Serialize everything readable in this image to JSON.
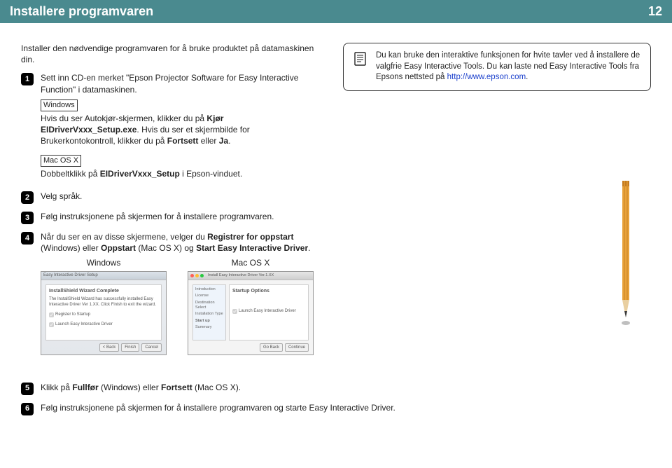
{
  "header": {
    "title": "Installere programvaren",
    "page": "12"
  },
  "intro": "Installer den nødvendige programvaren for å bruke produktet på datamaskinen din.",
  "steps": {
    "s1": {
      "num": "1",
      "text": "Sett inn CD-en merket \"Epson Projector Software for Easy Interactive Function\" i datamaskinen.",
      "win_label": "Windows",
      "win_p1a": "Hvis du ser Autokjør-skjermen, klikker du på ",
      "win_p1b": "Kjør EIDriverVxxx_Setup.exe",
      "win_p1c": ". Hvis du ser et skjermbilde for Brukerkontokontroll, klikker du på ",
      "win_p1d": "Fortsett",
      "win_p1e": " eller ",
      "win_p1f": "Ja",
      "win_p1g": ".",
      "mac_label": "Mac OS X",
      "mac_p1a": "Dobbeltklikk på ",
      "mac_p1b": "EIDriverVxxx_Setup",
      "mac_p1c": " i Epson-vinduet."
    },
    "s2": {
      "num": "2",
      "text": "Velg språk."
    },
    "s3": {
      "num": "3",
      "text": "Følg instruksjonene på skjermen for å installere programvaren."
    },
    "s4": {
      "num": "4",
      "p1a": "Når du ser en av disse skjermene, velger du ",
      "p1b": "Registrer for oppstart",
      "p1c": " (Windows) eller ",
      "p1d": "Oppstart",
      "p1e": " (Mac OS X) og ",
      "p1f": "Start Easy Interactive Driver",
      "p1g": ".",
      "win_label": "Windows",
      "mac_label": "Mac OS X",
      "shot_win": {
        "titlebar": "Easy Interactive Driver Setup",
        "h": "InstallShield Wizard Complete",
        "body": "The InstallShield Wizard has successfully installed Easy Interactive Driver Ver 1.XX. Click Finish to exit the wizard.",
        "chk1": "Register to Startup",
        "chk2": "Launch Easy Interactive Driver",
        "btn_back": "< Back",
        "btn_finish": "Finish",
        "btn_cancel": "Cancel"
      },
      "shot_mac": {
        "titlebar": "Install Easy Interactive Driver Ver.1.XX",
        "main_h": "Startup Options",
        "side1": "Introduction",
        "side2": "License",
        "side3": "Destination Select",
        "side4": "Installation Type",
        "side5": "Start up",
        "side6": "Summary",
        "chk": "Launch Easy Interactive Driver",
        "btn_back": "Go Back",
        "btn_cont": "Continue"
      }
    },
    "s5": {
      "num": "5",
      "p1a": "Klikk på ",
      "p1b": "Fullfør",
      "p1c": " (Windows) eller ",
      "p1d": "Fortsett",
      "p1e": " (Mac OS X)."
    },
    "s6": {
      "num": "6",
      "text": "Følg instruksjonene på skjermen for å installere programvaren og starte Easy Interactive Driver."
    }
  },
  "note": {
    "p1": "Du kan bruke den interaktive funksjonen for hvite tavler ved å installere de valgfrie Easy Interactive Tools. Du kan laste ned Easy Interactive Tools fra Epsons nettsted på ",
    "link": "http://www.epson.com",
    "p2": "."
  }
}
